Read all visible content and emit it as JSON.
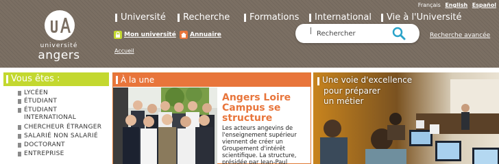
{
  "header": {
    "logo": {
      "name_top": "université",
      "name": "angers"
    },
    "languages": {
      "current": "Français",
      "links": [
        "English",
        "Español"
      ]
    },
    "nav": [
      "Université",
      "Recherche",
      "Formations",
      "International",
      "Vie à l'Université"
    ],
    "utility": {
      "mon_universite": "Mon université",
      "annuaire": "Annuaire",
      "accueil": "Accueil"
    },
    "search": {
      "placeholder": "Rechercher",
      "advanced": "Recherche avancée"
    }
  },
  "vous_etes": {
    "title": "Vous êtes :",
    "items": [
      "Lycéen",
      "Étudiant",
      "Étudiant international",
      "Chercheur étranger",
      "Salarié non salarié",
      "Doctorant",
      "Entreprise"
    ]
  },
  "a_la_une": {
    "title": "À la une",
    "headline": "Angers Loire Campus se structure",
    "body": "Les acteurs angevins de l'enseignement supérieur viennent de créer un Groupement d'intérêt scientifique. La structure, présidée par Jean-Paul"
  },
  "excellence": {
    "line1": "Une voie d'excellence",
    "line2": "pour préparer",
    "line3": "un métier"
  },
  "colors": {
    "header_bg": "#7b6f63",
    "green_accent": "#c3d82f",
    "orange_accent": "#e8753b"
  }
}
